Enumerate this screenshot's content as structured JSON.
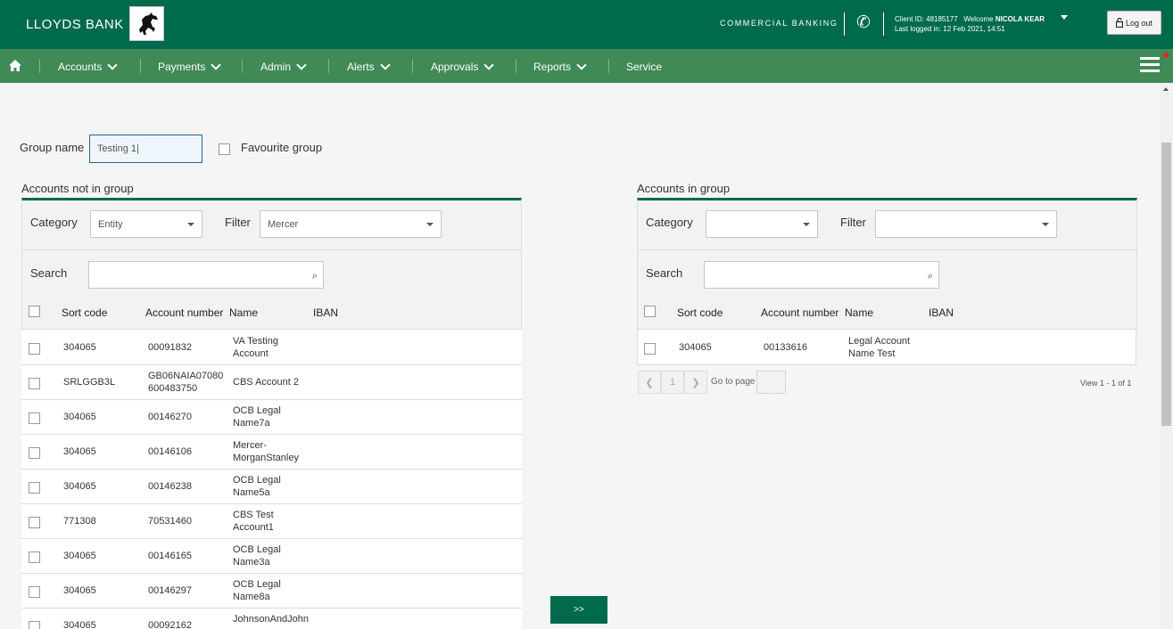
{
  "header": {
    "brand": "LLOYDS BANK",
    "section": "COMMERCIAL BANKING",
    "client_id": "Client ID: 48185177",
    "welcome_prefix": "Welcome",
    "welcome_name": "NICOLA KEAR",
    "last_logged": "Last logged in: 12 Feb 2021, 14:51",
    "logout_label": "Log out"
  },
  "nav": {
    "items": [
      {
        "label": "Accounts"
      },
      {
        "label": "Payments"
      },
      {
        "label": "Admin"
      },
      {
        "label": "Alerts"
      },
      {
        "label": "Approvals"
      },
      {
        "label": "Reports"
      },
      {
        "label": "Service"
      }
    ]
  },
  "form": {
    "group_name_label": "Group name",
    "group_name_value": "Testing 1|",
    "favourite_label": "Favourite group"
  },
  "left_panel": {
    "title": "Accounts not in group",
    "category_label": "Category",
    "category_value": "Entity",
    "filter_label": "Filter",
    "filter_value": "Mercer",
    "search_label": "Search",
    "columns": [
      "Sort code",
      "Account number",
      "Name",
      "IBAN"
    ],
    "rows": [
      {
        "sort": "304065",
        "acct1": "00091832",
        "acct2": "",
        "name1": "VA Testing",
        "name2": "Account"
      },
      {
        "sort": "SRLGGB3L",
        "acct1": "GB06NAIA07080",
        "acct2": "600483750",
        "name1": "CBS Account 2",
        "name2": ""
      },
      {
        "sort": "304065",
        "acct1": "00146270",
        "acct2": "",
        "name1": "OCB Legal",
        "name2": "Name7a"
      },
      {
        "sort": "304065",
        "acct1": "00146106",
        "acct2": "",
        "name1": "Mercer-",
        "name2": "MorganStanley"
      },
      {
        "sort": "304065",
        "acct1": "00146238",
        "acct2": "",
        "name1": "OCB Legal",
        "name2": "Name5a"
      },
      {
        "sort": "771308",
        "acct1": "70531460",
        "acct2": "",
        "name1": "CBS Test",
        "name2": "Account1"
      },
      {
        "sort": "304065",
        "acct1": "00146165",
        "acct2": "",
        "name1": "OCB Legal",
        "name2": "Name3a"
      },
      {
        "sort": "304065",
        "acct1": "00146297",
        "acct2": "",
        "name1": "OCB Legal",
        "name2": "Name8a"
      },
      {
        "sort": "304065",
        "acct1": "00092162",
        "acct2": "",
        "name1": "JohnsonAndJohn",
        "name2": ""
      }
    ]
  },
  "right_panel": {
    "title": "Accounts in group",
    "category_label": "Category",
    "category_value": "",
    "filter_label": "Filter",
    "filter_value": "",
    "search_label": "Search",
    "columns": [
      "Sort code",
      "Account number",
      "Name",
      "IBAN"
    ],
    "rows": [
      {
        "sort": "304065",
        "acct1": "00133616",
        "name1": "Legal Account",
        "name2": "Name Test"
      }
    ],
    "pager": {
      "page": "1",
      "goto_label": "Go to page",
      "view_text": "View 1 - 1 of 1"
    }
  },
  "move_button_label": ">>"
}
